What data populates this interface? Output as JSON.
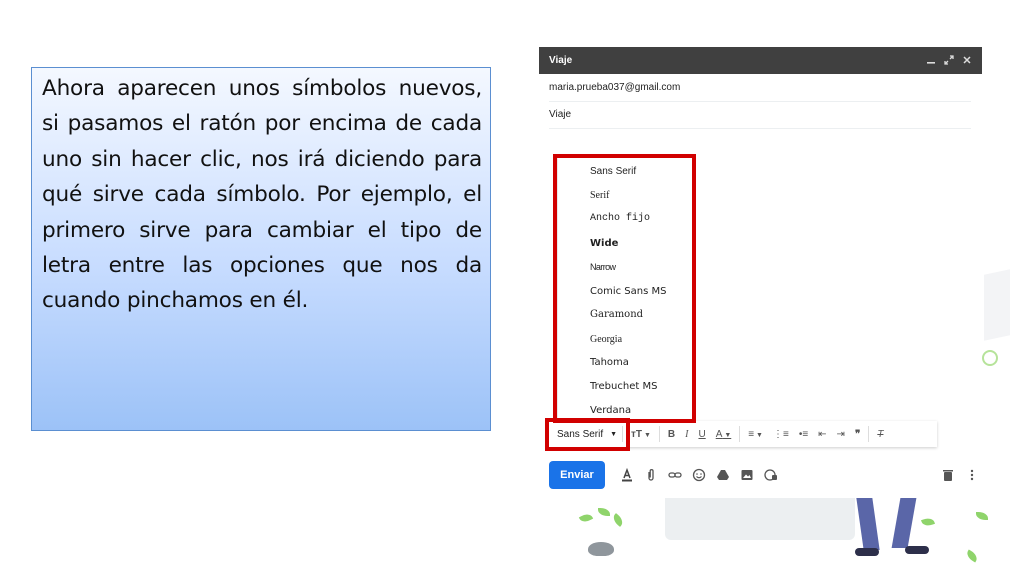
{
  "instructions": {
    "text": "Ahora aparecen unos símbolos nuevos, si pasamos el ratón por encima de cada uno sin hacer clic, nos irá diciendo para qué sirve cada símbolo. Por ejemplo, el primero sirve para cambiar el tipo de letra entre las opciones que nos da cuando pinchamos en él."
  },
  "compose": {
    "title": "Viaje",
    "controls": [
      "minimize-icon",
      "expand-icon",
      "close-icon"
    ],
    "to": "maria.prueba037@gmail.com",
    "subject": "Viaje",
    "font_menu": [
      "Sans Serif",
      "Serif",
      "Ancho fijo",
      "Wide",
      "Narrow",
      "Comic Sans MS",
      "Garamond",
      "Georgia",
      "Tahoma",
      "Trebuchet MS",
      "Verdana"
    ],
    "toolbar": {
      "font_label": "Sans Serif",
      "items": [
        "font-size-icon",
        "bold-icon",
        "italic-icon",
        "underline-icon",
        "text-color-icon",
        "align-icon",
        "numbered-list-icon",
        "bulleted-list-icon",
        "indent-less-icon",
        "indent-more-icon",
        "quote-icon",
        "remove-formatting-icon"
      ]
    },
    "send_label": "Enviar",
    "bottom_icons": [
      "formatting-icon",
      "attach-icon",
      "link-icon",
      "emoji-icon",
      "drive-icon",
      "photo-icon",
      "confidential-icon",
      "delete-icon",
      "more-options-icon"
    ]
  },
  "colors": {
    "send_button": "#1a73e8",
    "header": "#404040",
    "highlight": "#d10000",
    "textbox_fill": "#9cc2f7"
  }
}
